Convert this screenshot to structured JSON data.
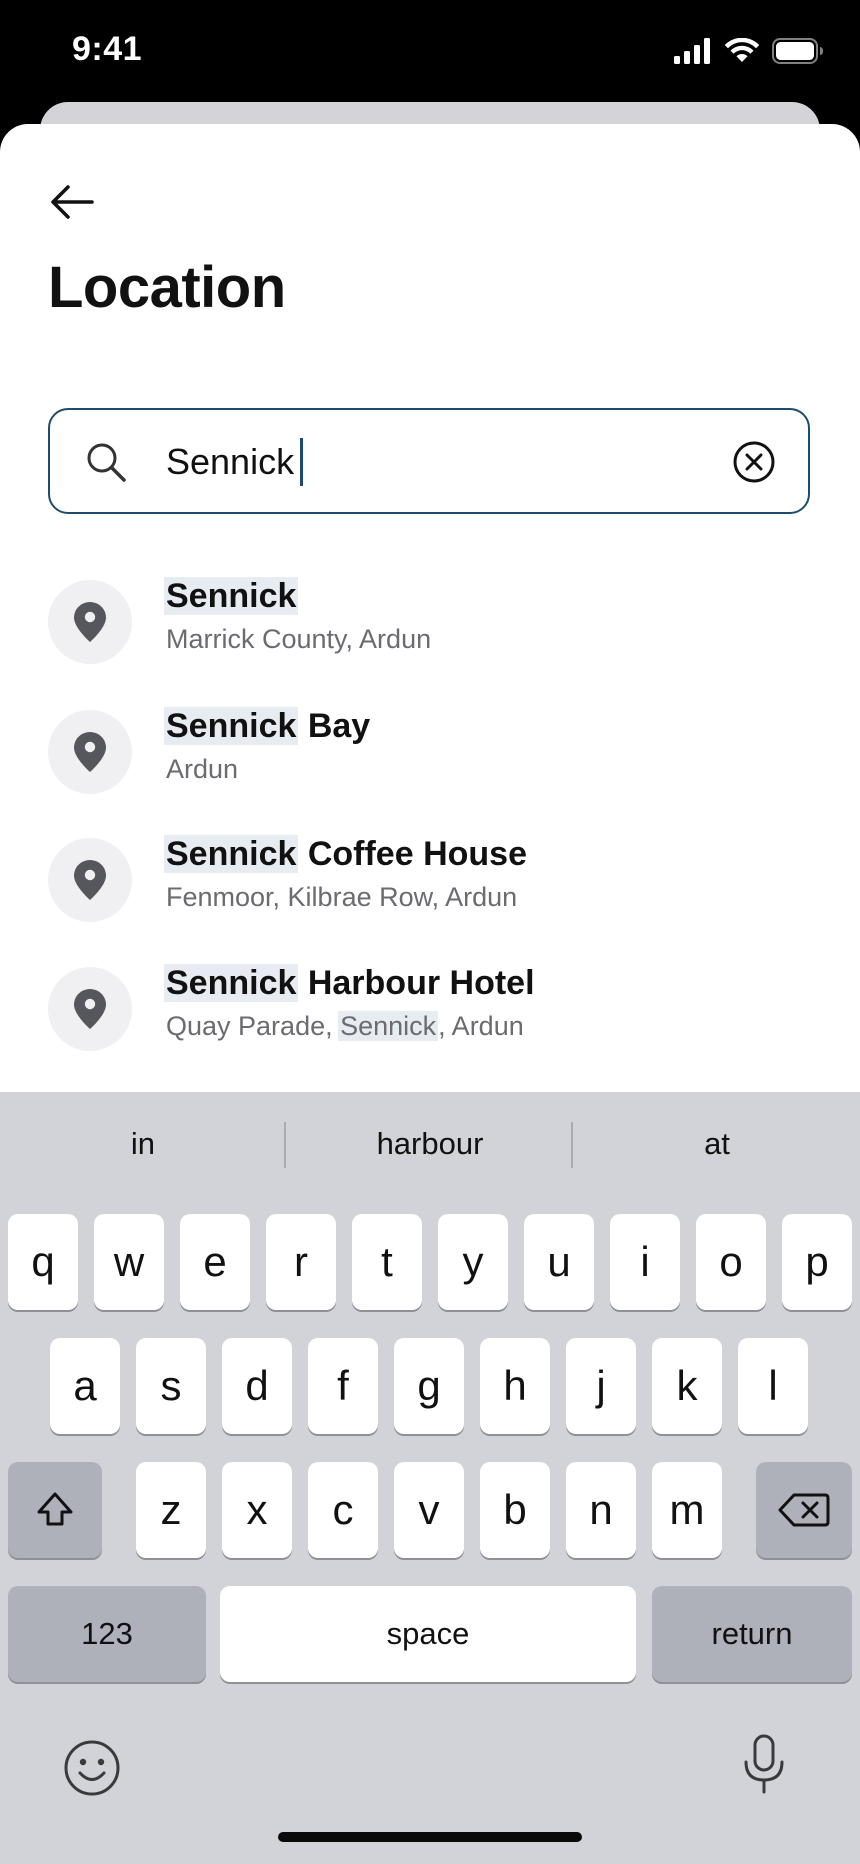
{
  "status_bar": {
    "time": "9:41"
  },
  "header": {
    "title": "Location"
  },
  "search": {
    "value": "Sennick"
  },
  "results": [
    {
      "title_match": "Sennick",
      "title_rest": "",
      "subtitle_before": "Marrick County, Ardun",
      "subtitle_match": "",
      "subtitle_after": ""
    },
    {
      "title_match": "Sennick",
      "title_rest": " Bay",
      "subtitle_before": "Ardun",
      "subtitle_match": "",
      "subtitle_after": ""
    },
    {
      "title_match": "Sennick",
      "title_rest": " Coffee House",
      "subtitle_before": "Fenmoor, Kilbrae Row, Ardun",
      "subtitle_match": "",
      "subtitle_after": ""
    },
    {
      "title_match": "Sennick",
      "title_rest": " Harbour Hotel",
      "subtitle_before": "Quay Parade, ",
      "subtitle_match": "Sennick",
      "subtitle_after": ", Ardun"
    }
  ],
  "keyboard": {
    "suggestions": [
      "in",
      "harbour",
      "at"
    ],
    "row1": [
      "q",
      "w",
      "e",
      "r",
      "t",
      "y",
      "u",
      "i",
      "o",
      "p"
    ],
    "row2": [
      "a",
      "s",
      "d",
      "f",
      "g",
      "h",
      "j",
      "k",
      "l"
    ],
    "row3": [
      "z",
      "x",
      "c",
      "v",
      "b",
      "n",
      "m"
    ],
    "numbers_label": "123",
    "space_label": "space",
    "return_label": "return"
  },
  "colors": {
    "accent": "#1f4b6e",
    "highlight": "#e6ecf2",
    "keyboard_bg": "#d1d3d9"
  }
}
